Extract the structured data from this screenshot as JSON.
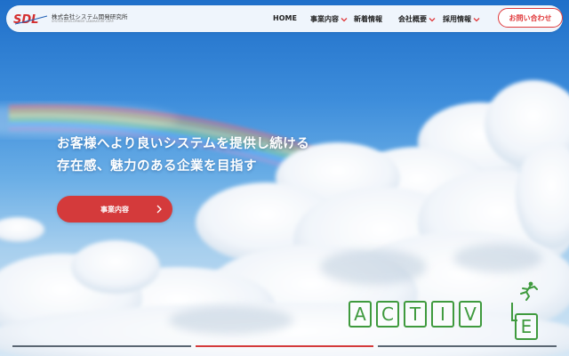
{
  "header": {
    "logo_mark": "SDL",
    "company_name": "株式会社システム開発研究所",
    "company_name_en": "SYSTEM DEVELOPMENT LABORATORY CORP.",
    "nav": [
      {
        "label": "HOME",
        "has_dropdown": false
      },
      {
        "label": "事業内容",
        "has_dropdown": true
      },
      {
        "label": "新着情報",
        "has_dropdown": false
      },
      {
        "label": "会社概要",
        "has_dropdown": true
      },
      {
        "label": "採用情報",
        "has_dropdown": true
      }
    ],
    "contact_label": "お問い合わせ"
  },
  "hero": {
    "headline_line1": "お客様へより良いシステムを提供し続ける",
    "headline_line2": "存在感、魅力のある企業を目指す",
    "cta_label": "事業内容",
    "cta_icon": "chevron-right-icon"
  },
  "active_logo": {
    "letters": [
      "A",
      "C",
      "T",
      "I",
      "V",
      "E"
    ],
    "icon": "runner-icon"
  },
  "slider": {
    "slide_count": 3,
    "active_slide": 2
  },
  "colors": {
    "accent": "#d43a3b",
    "active_green": "#3f9a3e",
    "sky_top": "#1f6fc9",
    "header_bg": "#ffffff",
    "progress_inactive": "#5a6672"
  }
}
